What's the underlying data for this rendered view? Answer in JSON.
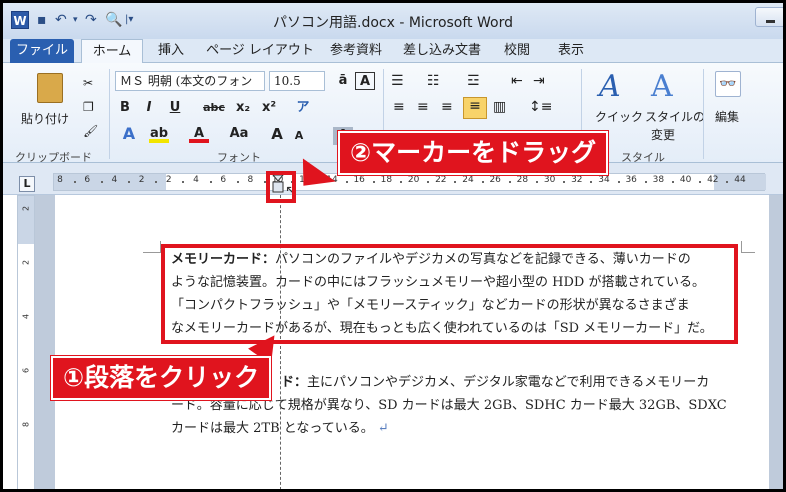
{
  "window": {
    "app_icon": "W",
    "title": "パソコン用語.docx - Microsoft Word",
    "quick_access": [
      "save-icon",
      "undo-icon",
      "redo-icon",
      "print-preview-icon",
      "customize-icon"
    ]
  },
  "tabs": [
    "ファイル",
    "ホーム",
    "挿入",
    "ページ レイアウト",
    "参考資料",
    "差し込み文書",
    "校閲",
    "表示"
  ],
  "ribbon": {
    "clipboard": {
      "paste_label": "貼り付け",
      "group_label": "クリップボード"
    },
    "font": {
      "font_name": "ＭＳ 明朝 (本文のフォン",
      "font_size": "10.5",
      "group_label": "フォント",
      "bold": "B",
      "italic": "I",
      "underline": "U",
      "strike": "abc",
      "subscript": "x₂",
      "superscript": "x²",
      "font_color": "A",
      "change_case": "Aa",
      "grow": "A",
      "shrink": "A"
    },
    "styles": {
      "quick_style_label": "クイック",
      "quick_style_label2": "スタイル",
      "change_style_label": "スタイルの",
      "change_style_label2": "変更",
      "group_label": "スタイル"
    },
    "editing": {
      "label": "編集"
    }
  },
  "ruler": {
    "tab_selector": "L",
    "ticks": [
      "8",
      "6",
      "4",
      "2",
      "2",
      "4",
      "6",
      "8",
      "10",
      "12",
      "14",
      "16",
      "18",
      "20",
      "22",
      "24",
      "26",
      "28",
      "30",
      "32",
      "34",
      "36",
      "38",
      "40",
      "42",
      "44"
    ],
    "vertical_ticks": [
      "2",
      "2",
      "4",
      "6",
      "8"
    ]
  },
  "document": {
    "p1": {
      "bold_term": "メモリーカード：",
      "lines": [
        "パソコンのファイルやデジカメの写真などを記録できる、薄いカードの",
        "ような記憶装置。カードの中にはフラッシュメモリーや超小型の HDD が搭載されている。",
        "「コンパクトフラッシュ」や「メモリースティック」などカードの形状が異なるさまざま",
        "なメモリーカードがあるが、現在もっとも広く使われているのは「SD メモリーカード」だ。"
      ]
    },
    "p2": {
      "bold_term": "ド：",
      "lines": [
        "主にパソコンやデジカメ、デジタル家電などで利用できるメモリーカ",
        "ード。容量に応じて規格が異なり、SD カードは最大 2GB、SDHC カード最大 32GB、SDXC",
        "カードは最大 2TB となっている。"
      ],
      "paragraph_mark": "↵"
    }
  },
  "callouts": {
    "drag": "②マーカーをドラッグ",
    "click": "①段落をクリック"
  },
  "colors": {
    "accent": "#e0141e",
    "file_tab": "#2a5fb0"
  }
}
